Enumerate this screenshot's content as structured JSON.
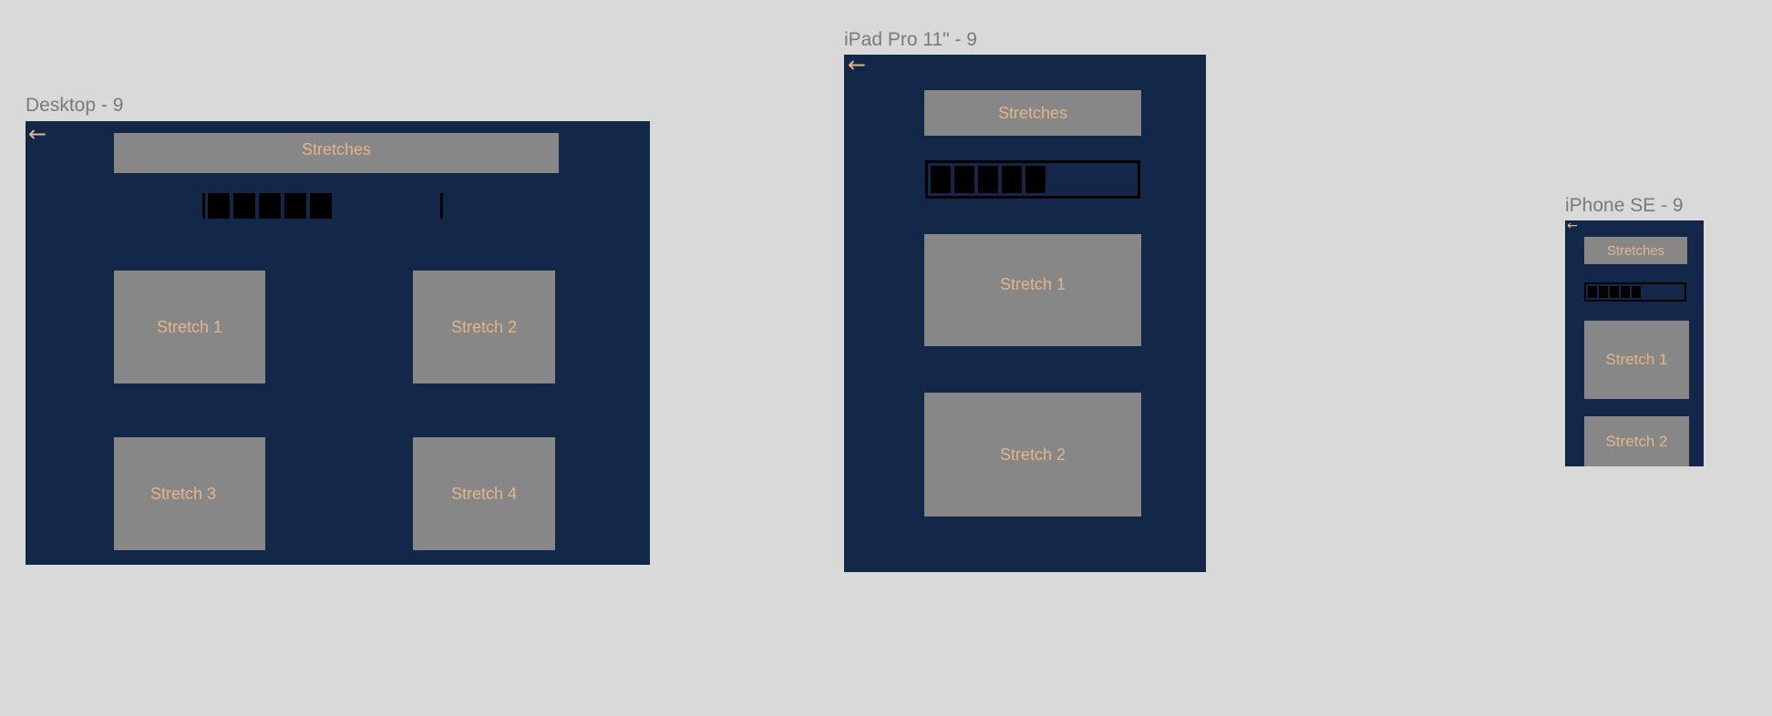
{
  "desktop": {
    "label": "Desktop - 9",
    "back_icon": "←",
    "title": "Stretches",
    "progress": {
      "filled": 5
    },
    "cards": [
      "Stretch 1",
      "Stretch 2",
      "Stretch 3",
      "Stretch 4"
    ]
  },
  "ipad": {
    "label": "iPad Pro 11\" - 9",
    "back_icon": "←",
    "title": "Stretches",
    "progress": {
      "filled": 5
    },
    "cards": [
      "Stretch 1",
      "Stretch 2"
    ]
  },
  "iphone": {
    "label": "iPhone SE - 9",
    "back_icon": "←",
    "title": "Stretches",
    "progress": {
      "filled": 5
    },
    "cards": [
      "Stretch 1",
      "Stretch 2"
    ]
  },
  "colors": {
    "canvas": "#d9d9d9",
    "frame": "#132848",
    "box": "#878787",
    "accent": "#e3b589",
    "label": "#7a7a7a"
  }
}
